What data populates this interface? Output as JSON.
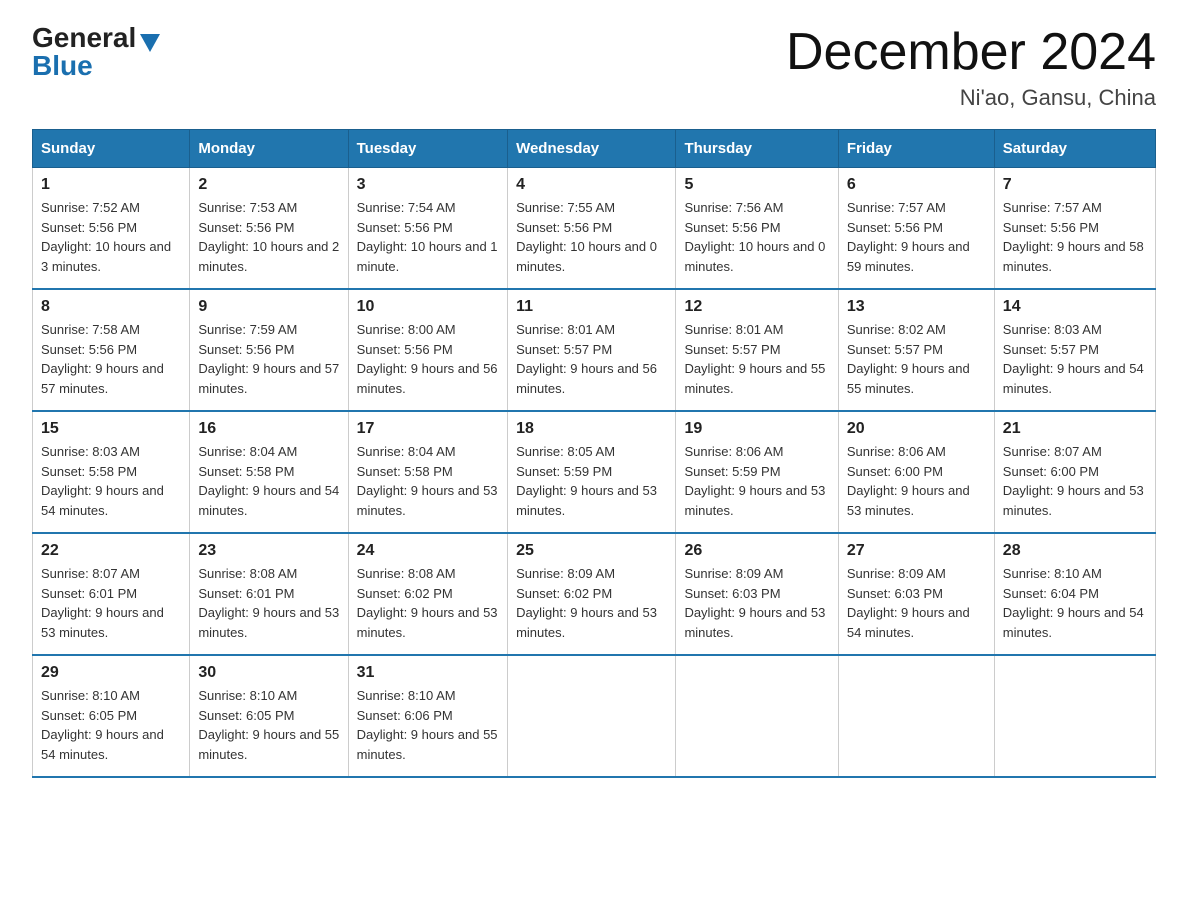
{
  "logo": {
    "general": "General",
    "blue": "Blue"
  },
  "title": "December 2024",
  "subtitle": "Ni'ao, Gansu, China",
  "weekdays": [
    "Sunday",
    "Monday",
    "Tuesday",
    "Wednesday",
    "Thursday",
    "Friday",
    "Saturday"
  ],
  "weeks": [
    [
      {
        "day": "1",
        "sunrise": "7:52 AM",
        "sunset": "5:56 PM",
        "daylight": "10 hours and 3 minutes."
      },
      {
        "day": "2",
        "sunrise": "7:53 AM",
        "sunset": "5:56 PM",
        "daylight": "10 hours and 2 minutes."
      },
      {
        "day": "3",
        "sunrise": "7:54 AM",
        "sunset": "5:56 PM",
        "daylight": "10 hours and 1 minute."
      },
      {
        "day": "4",
        "sunrise": "7:55 AM",
        "sunset": "5:56 PM",
        "daylight": "10 hours and 0 minutes."
      },
      {
        "day": "5",
        "sunrise": "7:56 AM",
        "sunset": "5:56 PM",
        "daylight": "10 hours and 0 minutes."
      },
      {
        "day": "6",
        "sunrise": "7:57 AM",
        "sunset": "5:56 PM",
        "daylight": "9 hours and 59 minutes."
      },
      {
        "day": "7",
        "sunrise": "7:57 AM",
        "sunset": "5:56 PM",
        "daylight": "9 hours and 58 minutes."
      }
    ],
    [
      {
        "day": "8",
        "sunrise": "7:58 AM",
        "sunset": "5:56 PM",
        "daylight": "9 hours and 57 minutes."
      },
      {
        "day": "9",
        "sunrise": "7:59 AM",
        "sunset": "5:56 PM",
        "daylight": "9 hours and 57 minutes."
      },
      {
        "day": "10",
        "sunrise": "8:00 AM",
        "sunset": "5:56 PM",
        "daylight": "9 hours and 56 minutes."
      },
      {
        "day": "11",
        "sunrise": "8:01 AM",
        "sunset": "5:57 PM",
        "daylight": "9 hours and 56 minutes."
      },
      {
        "day": "12",
        "sunrise": "8:01 AM",
        "sunset": "5:57 PM",
        "daylight": "9 hours and 55 minutes."
      },
      {
        "day": "13",
        "sunrise": "8:02 AM",
        "sunset": "5:57 PM",
        "daylight": "9 hours and 55 minutes."
      },
      {
        "day": "14",
        "sunrise": "8:03 AM",
        "sunset": "5:57 PM",
        "daylight": "9 hours and 54 minutes."
      }
    ],
    [
      {
        "day": "15",
        "sunrise": "8:03 AM",
        "sunset": "5:58 PM",
        "daylight": "9 hours and 54 minutes."
      },
      {
        "day": "16",
        "sunrise": "8:04 AM",
        "sunset": "5:58 PM",
        "daylight": "9 hours and 54 minutes."
      },
      {
        "day": "17",
        "sunrise": "8:04 AM",
        "sunset": "5:58 PM",
        "daylight": "9 hours and 53 minutes."
      },
      {
        "day": "18",
        "sunrise": "8:05 AM",
        "sunset": "5:59 PM",
        "daylight": "9 hours and 53 minutes."
      },
      {
        "day": "19",
        "sunrise": "8:06 AM",
        "sunset": "5:59 PM",
        "daylight": "9 hours and 53 minutes."
      },
      {
        "day": "20",
        "sunrise": "8:06 AM",
        "sunset": "6:00 PM",
        "daylight": "9 hours and 53 minutes."
      },
      {
        "day": "21",
        "sunrise": "8:07 AM",
        "sunset": "6:00 PM",
        "daylight": "9 hours and 53 minutes."
      }
    ],
    [
      {
        "day": "22",
        "sunrise": "8:07 AM",
        "sunset": "6:01 PM",
        "daylight": "9 hours and 53 minutes."
      },
      {
        "day": "23",
        "sunrise": "8:08 AM",
        "sunset": "6:01 PM",
        "daylight": "9 hours and 53 minutes."
      },
      {
        "day": "24",
        "sunrise": "8:08 AM",
        "sunset": "6:02 PM",
        "daylight": "9 hours and 53 minutes."
      },
      {
        "day": "25",
        "sunrise": "8:09 AM",
        "sunset": "6:02 PM",
        "daylight": "9 hours and 53 minutes."
      },
      {
        "day": "26",
        "sunrise": "8:09 AM",
        "sunset": "6:03 PM",
        "daylight": "9 hours and 53 minutes."
      },
      {
        "day": "27",
        "sunrise": "8:09 AM",
        "sunset": "6:03 PM",
        "daylight": "9 hours and 54 minutes."
      },
      {
        "day": "28",
        "sunrise": "8:10 AM",
        "sunset": "6:04 PM",
        "daylight": "9 hours and 54 minutes."
      }
    ],
    [
      {
        "day": "29",
        "sunrise": "8:10 AM",
        "sunset": "6:05 PM",
        "daylight": "9 hours and 54 minutes."
      },
      {
        "day": "30",
        "sunrise": "8:10 AM",
        "sunset": "6:05 PM",
        "daylight": "9 hours and 55 minutes."
      },
      {
        "day": "31",
        "sunrise": "8:10 AM",
        "sunset": "6:06 PM",
        "daylight": "9 hours and 55 minutes."
      },
      null,
      null,
      null,
      null
    ]
  ],
  "labels": {
    "sunrise": "Sunrise:",
    "sunset": "Sunset:",
    "daylight": "Daylight:"
  }
}
